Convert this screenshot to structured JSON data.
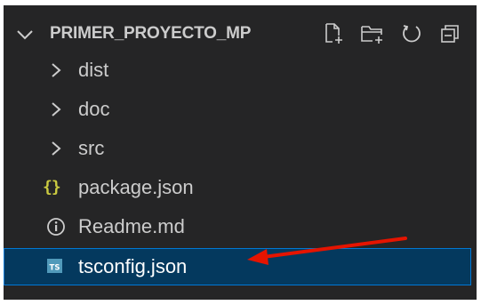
{
  "explorer": {
    "title": "PRIMER_PROYECTO_MP",
    "actions": [
      {
        "name": "new-file",
        "icon": "new-file-icon"
      },
      {
        "name": "new-folder",
        "icon": "new-folder-icon"
      },
      {
        "name": "refresh",
        "icon": "refresh-icon"
      },
      {
        "name": "collapse-all",
        "icon": "collapse-all-icon"
      }
    ],
    "items": [
      {
        "label": "dist",
        "type": "folder",
        "icon": "chevron-right-icon"
      },
      {
        "label": "doc",
        "type": "folder",
        "icon": "chevron-right-icon"
      },
      {
        "label": "src",
        "type": "folder",
        "icon": "chevron-right-icon"
      },
      {
        "label": "package.json",
        "type": "file",
        "icon": "json-braces-icon"
      },
      {
        "label": "Readme.md",
        "type": "file",
        "icon": "info-icon"
      },
      {
        "label": "tsconfig.json",
        "type": "file",
        "icon": "typescript-icon",
        "selected": true
      }
    ],
    "braces_glyph": "{}",
    "ts_glyph": "TS",
    "info_glyph": "i"
  },
  "colors": {
    "background": "#252526",
    "text": "#cccccc",
    "selection": "#04395e",
    "selection_border": "#0078d4",
    "json_icon": "#cbcb41",
    "ts_icon": "#519aba",
    "annotation_arrow": "#e51400"
  }
}
